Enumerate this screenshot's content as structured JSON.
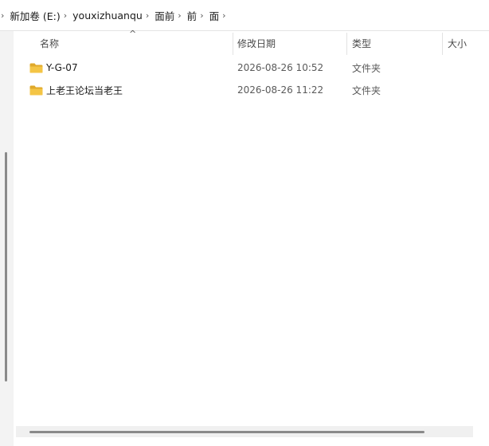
{
  "breadcrumb": [
    "新加卷 (E:)",
    "youxizhuanqu",
    "面前",
    "前",
    "面"
  ],
  "columns": {
    "name": "名称",
    "modified": "修改日期",
    "type": "类型",
    "size": "大小"
  },
  "sort_indicator": "^",
  "files": [
    {
      "name": "Y-G-07",
      "modified": "2026-08-26 10:52",
      "type": "文件夹"
    },
    {
      "name": "上老王论坛当老王",
      "modified": "2026-08-26 11:22",
      "type": "文件夹"
    }
  ],
  "colors": {
    "folder": "#f4c545",
    "folder_dark": "#e0a92b"
  }
}
